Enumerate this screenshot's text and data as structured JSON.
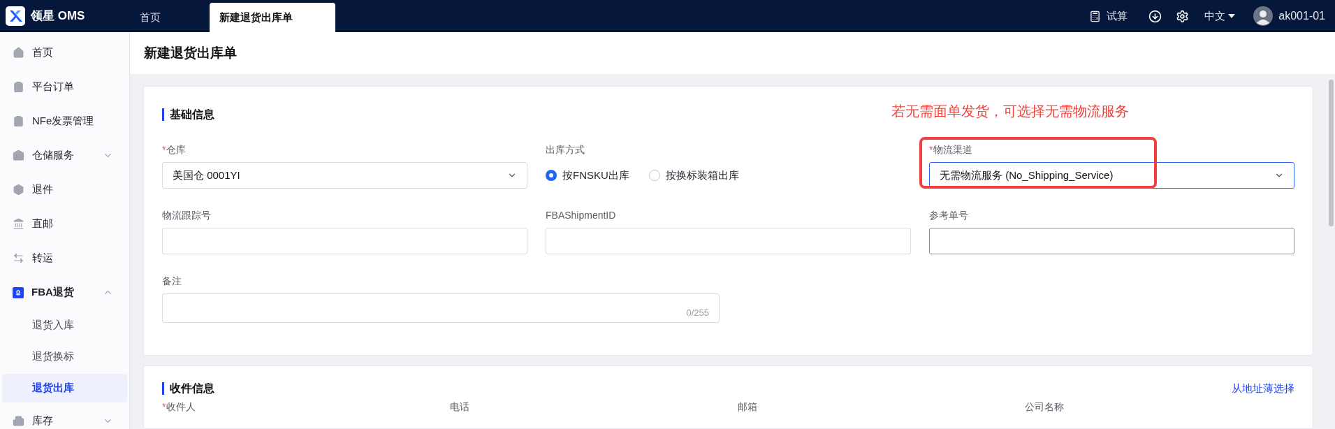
{
  "topbar": {
    "brand": "领星 OMS",
    "tabs": [
      {
        "label": "首页",
        "selected": false
      },
      {
        "label": "新建退货出库单",
        "selected": true
      }
    ],
    "calc": "试算",
    "language": "中文",
    "user": "ak001-01"
  },
  "sidebar": {
    "items": [
      {
        "label": "首页",
        "selected": false
      },
      {
        "label": "平台订单",
        "selected": false
      },
      {
        "label": "NFe发票管理",
        "selected": false
      },
      {
        "label": "仓储服务",
        "selected": false,
        "expanded": false
      },
      {
        "label": "退件",
        "selected": false
      },
      {
        "label": "直邮",
        "selected": false
      },
      {
        "label": "转运",
        "selected": false
      },
      {
        "label": "FBA退货",
        "selected": false,
        "expanded": true,
        "children": [
          {
            "label": "退货入库",
            "selected": false
          },
          {
            "label": "退货换标",
            "selected": false
          },
          {
            "label": "退货出库",
            "selected": true
          }
        ]
      },
      {
        "label": "库存",
        "selected": false,
        "expanded": false
      }
    ]
  },
  "page_title": "新建退货出库单",
  "basic_info": {
    "title": "基础信息",
    "annotation": "若无需面单发货，可选择无需物流服务",
    "fields": [
      {
        "kind": "select",
        "required_mark": "*",
        "label": "仓库",
        "value": "美国仓 0001YI",
        "focused": false
      },
      {
        "kind": "radio",
        "label": "出库方式",
        "options": [
          {
            "label": "按FNSKU出库",
            "selected": true
          },
          {
            "label": "按换标装箱出库",
            "selected": false
          }
        ]
      },
      {
        "kind": "select",
        "required_mark": "*",
        "label": "物流渠道",
        "value": "无需物流服务 (No_Shipping_Service)",
        "focused": true,
        "highlighted": true
      },
      {
        "kind": "input",
        "label": "物流跟踪号",
        "focused": false
      },
      {
        "kind": "input",
        "label": "FBAShipmentID",
        "focused": false
      },
      {
        "kind": "input",
        "label": "参考单号",
        "focused": true
      }
    ],
    "remark": {
      "label": "备注",
      "counter": "0/255"
    }
  },
  "recipient_info": {
    "title": "收件信息",
    "link": "从地址薄选择",
    "fields": [
      {
        "required_mark": "*",
        "label": "收件人"
      },
      {
        "label": "电话"
      },
      {
        "label": "邮箱"
      },
      {
        "label": "公司名称"
      }
    ]
  }
}
